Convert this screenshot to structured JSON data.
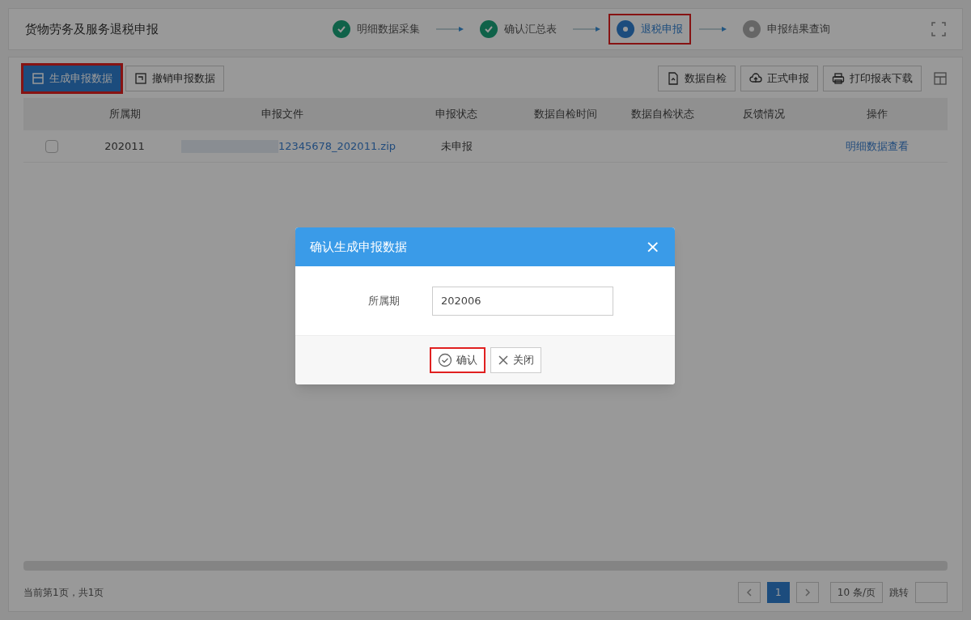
{
  "header": {
    "title": "货物劳务及服务退税申报",
    "steps": [
      {
        "label": "明细数据采集",
        "kind": "done",
        "selected": false
      },
      {
        "label": "确认汇总表",
        "kind": "done",
        "selected": false
      },
      {
        "label": "退税申报",
        "kind": "current",
        "selected": true
      },
      {
        "label": "申报结果查询",
        "kind": "todo",
        "selected": false
      }
    ]
  },
  "toolbar": {
    "left": [
      {
        "label": "生成申报数据",
        "selected": true,
        "kind": "table"
      },
      {
        "label": "撤销申报数据",
        "selected": false,
        "kind": "undo"
      }
    ],
    "right": [
      {
        "label": "数据自检",
        "kind": "file"
      },
      {
        "label": "正式申报",
        "kind": "upload"
      },
      {
        "label": "打印报表下载",
        "kind": "print"
      }
    ]
  },
  "table": {
    "columns": [
      "所属期",
      "申报文件",
      "申报状态",
      "数据自检时间",
      "数据自检状态",
      "反馈情况",
      "操作"
    ],
    "rows": [
      {
        "checked": false,
        "cells": [
          "202011",
          "12345678_202011.zip",
          "未申报",
          "",
          "",
          "",
          "明细数据查看"
        ]
      }
    ]
  },
  "dialog": {
    "title": "确认生成申报数据",
    "close": "×",
    "field_label": "所属期",
    "field_value": "202006",
    "buttons": [
      {
        "label": "确认",
        "kind": "check",
        "selected": true
      },
      {
        "label": "关闭",
        "kind": "x",
        "selected": false
      }
    ]
  },
  "footer": {
    "info": "当前第1页，共1页",
    "pages": [
      {
        "label": "1",
        "selected": true
      }
    ],
    "page_size": "10 条/页",
    "jump": "跳转"
  }
}
